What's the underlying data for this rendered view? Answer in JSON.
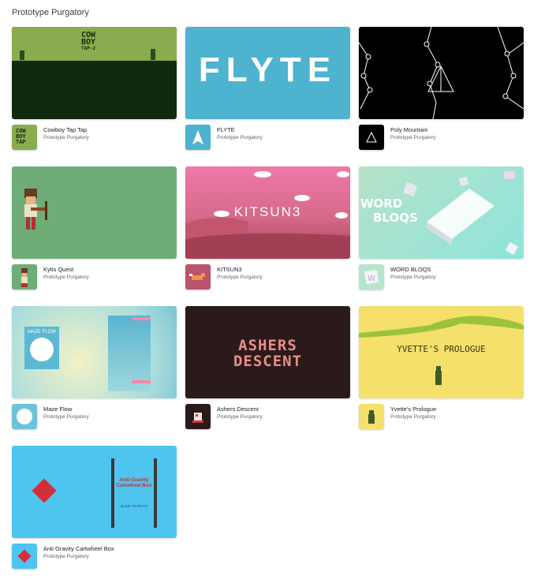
{
  "header": {
    "title": "Prototype Purgatory"
  },
  "games": [
    {
      "title": "Cowboy Tap Tap",
      "developer": "Prototype Purgatory",
      "art_text": [
        "COW",
        "BOY",
        "TAP-2"
      ],
      "icon": "cowboy-icon"
    },
    {
      "title": "FLYTE",
      "developer": "Prototype Purgatory",
      "art_text": "FLYTE",
      "icon": "paper-plane-icon"
    },
    {
      "title": "Poly Mountain",
      "developer": "Prototype Purgatory",
      "icon": "triangle-icon"
    },
    {
      "title": "Kytis Quest",
      "developer": "Prototype Purgatory",
      "icon": "archer-icon"
    },
    {
      "title": "KITSUN3",
      "developer": "Prototype Purgatory",
      "art_text": "KITSUN3",
      "icon": "fox-icon"
    },
    {
      "title": "WORD BLOQS",
      "developer": "Prototype Purgatory",
      "art_text": [
        "WORD",
        "BLOQS"
      ],
      "icon": "letter-block-icon"
    },
    {
      "title": "Maze Flow",
      "developer": "Prototype Purgatory",
      "art_text": "MAZE FLOW",
      "icon": "smiley-face-icon"
    },
    {
      "title": "Ashers Descent",
      "developer": "Prototype Purgatory",
      "art_text": [
        "ASHERS",
        "DESCENT"
      ],
      "icon": "creature-icon"
    },
    {
      "title": "Yvette's Prologue",
      "developer": "Prototype Purgatory",
      "art_text": "YVETTE'S PROLOGUE",
      "icon": "wanderer-icon"
    },
    {
      "title": "Anti Gravity Cartwheel Box",
      "developer": "Prototype Purgatory",
      "art_text": [
        "Anti-Gravity",
        "Cartwheel Box",
        "CLICK TO PLAY!"
      ],
      "icon": "red-diamond-icon"
    }
  ],
  "colors": {
    "cowboy_sky": "#8bac4e",
    "cowboy_ground": "#0f2a10",
    "flyte": "#4db3cf",
    "poly": "#000000",
    "kytis": "#6ead78",
    "kitsune_pink": "#f078a8",
    "wordbloqs": "#a6e3d4",
    "mazeflow": "#bfe6e0",
    "ashers": "#2a1b1a",
    "ashers_text": "#e98c88",
    "yvette": "#f4e06a",
    "antigravity": "#4dc5ef",
    "diamond": "#d32f3a"
  }
}
